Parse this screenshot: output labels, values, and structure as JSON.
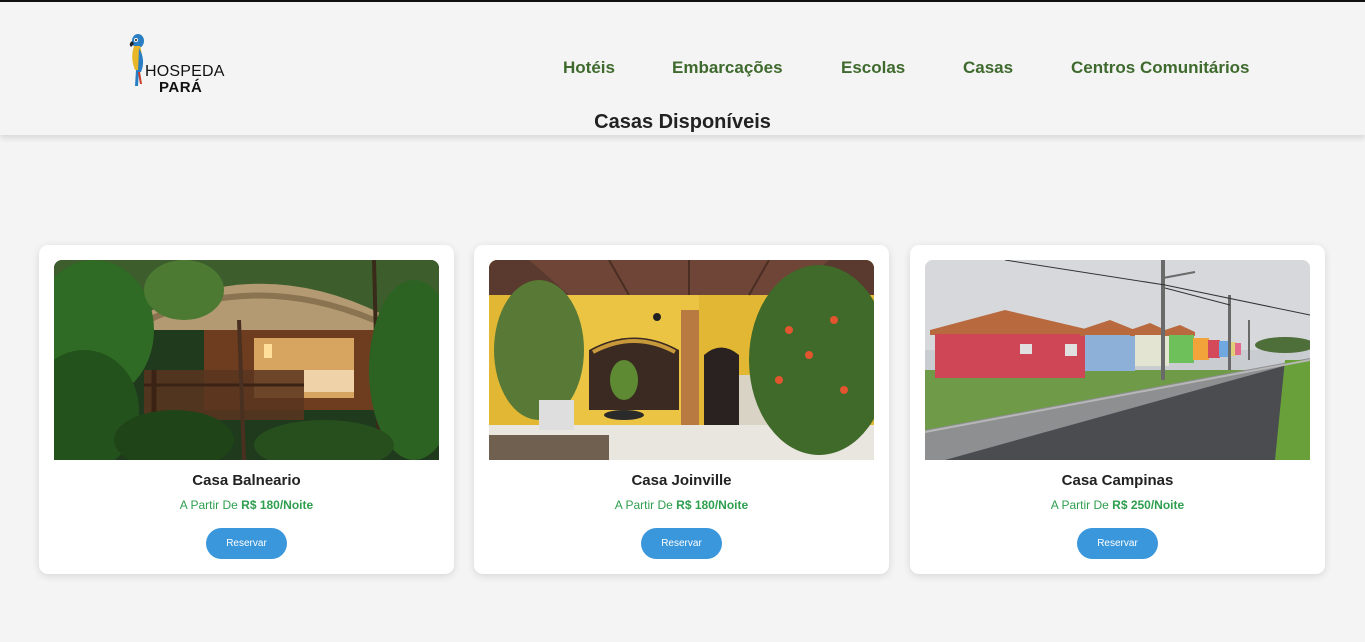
{
  "brand": {
    "line1": "HOSPEDA",
    "line2": "PARÁ"
  },
  "nav": {
    "items": [
      {
        "label": "Hotéis"
      },
      {
        "label": "Embarcações"
      },
      {
        "label": "Escolas"
      },
      {
        "label": "Casas"
      },
      {
        "label": "Centros Comunitários"
      }
    ]
  },
  "page": {
    "title": "Casas Disponíveis"
  },
  "cards": [
    {
      "name": "Casa Balneario",
      "price_prefix": "A Partir De ",
      "price_value": "R$ 180/Noite",
      "button": "Reservar",
      "image": "jungle-lodge-photo"
    },
    {
      "name": "Casa Joinville",
      "price_prefix": "A Partir De ",
      "price_value": "R$ 180/Noite",
      "button": "Reservar",
      "image": "yellow-porch-photo"
    },
    {
      "name": "Casa Campinas",
      "price_prefix": "A Partir De ",
      "price_value": "R$ 250/Noite",
      "button": "Reservar",
      "image": "row-houses-street-photo"
    }
  ],
  "colors": {
    "nav": "#3f6a2e",
    "price": "#2e9e4f",
    "button": "#3a97db",
    "background": "#f4f4f4"
  }
}
